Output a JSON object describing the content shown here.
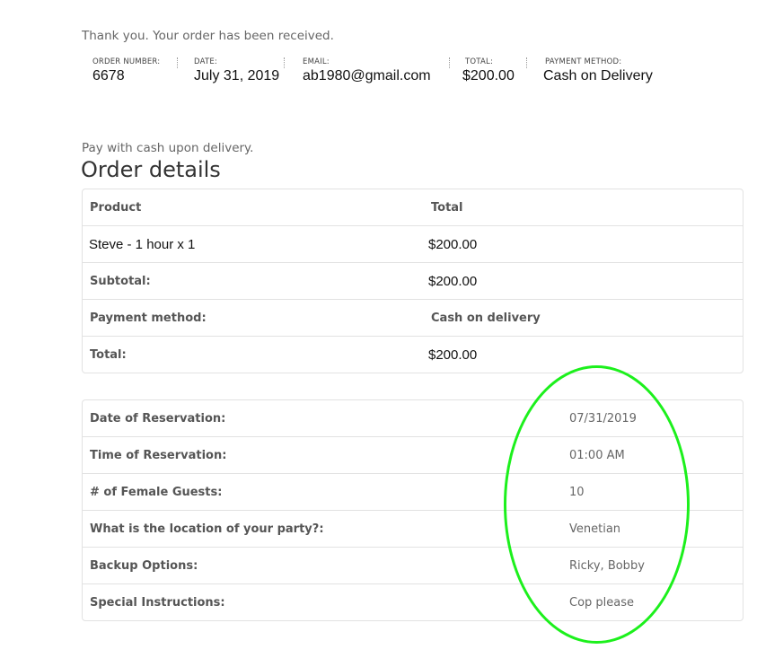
{
  "notice": "Thank you. Your order has been received.",
  "overview": {
    "order_number": {
      "label": "ORDER NUMBER:",
      "value": "6678"
    },
    "date": {
      "label": "DATE:",
      "value": "July 31, 2019"
    },
    "email": {
      "label": "EMAIL:",
      "value": "ab1980@gmail.com"
    },
    "total": {
      "label": "TOTAL:",
      "value": "$200.00"
    },
    "payment_method": {
      "label": "PAYMENT METHOD:",
      "value": "Cash on Delivery"
    }
  },
  "payment_note": "Pay with cash upon delivery.",
  "order_details": {
    "title": "Order details",
    "header": {
      "product": "Product",
      "total": "Total"
    },
    "item": {
      "name": "Steve - 1 hour x 1",
      "total": "$200.00"
    },
    "subtotal": {
      "label": "Subtotal:",
      "value": "$200.00"
    },
    "payment": {
      "label": "Payment method:",
      "value": "Cash on delivery"
    },
    "total": {
      "label": "Total:",
      "value": "$200.00"
    }
  },
  "reservation": [
    {
      "label": "Date of Reservation:",
      "value": "07/31/2019"
    },
    {
      "label": "Time of Reservation:",
      "value": "01:00 AM"
    },
    {
      "label": "# of Female Guests:",
      "value": "10"
    },
    {
      "label": "What is the location of your party?:",
      "value": "Venetian"
    },
    {
      "label": "Backup Options:",
      "value": "Ricky, Bobby"
    },
    {
      "label": "Special Instructions:",
      "value": "Cop please"
    }
  ],
  "colors": {
    "highlight": "#1cf01c",
    "border": "#e2e2e2",
    "label_text": "#555555"
  }
}
